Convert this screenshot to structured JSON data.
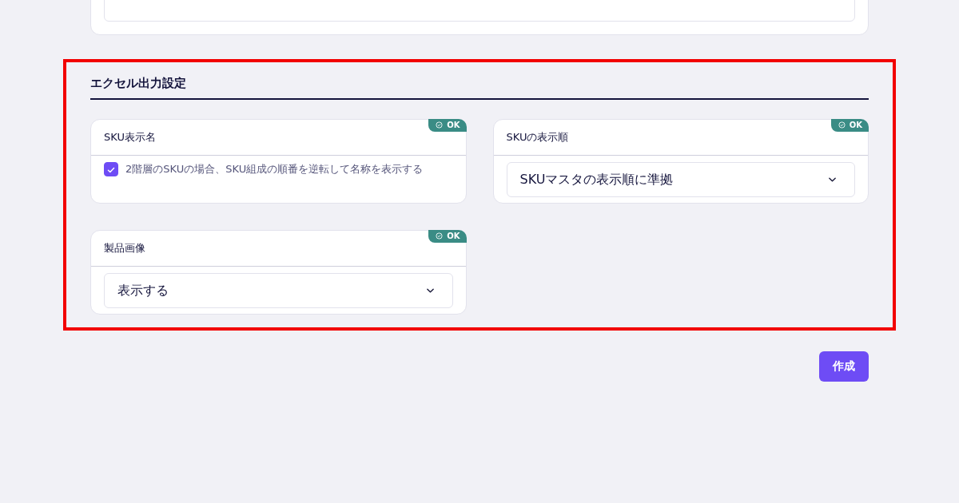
{
  "section": {
    "title": "エクセル出力設定",
    "highlighted": true,
    "settings": [
      {
        "kind": "checkbox",
        "label": "SKU表示名",
        "badge": "OK",
        "option": "2階層のSKUの場合、SKU組成の順番を逆転して名称を表示する",
        "checked": true
      },
      {
        "kind": "select",
        "label": "SKUの表示順",
        "badge": "OK",
        "value": "SKUマスタの表示順に準拠"
      },
      {
        "kind": "select",
        "label": "製品画像",
        "badge": "OK",
        "value": "表示する"
      }
    ]
  },
  "submit": {
    "label": "作成"
  }
}
